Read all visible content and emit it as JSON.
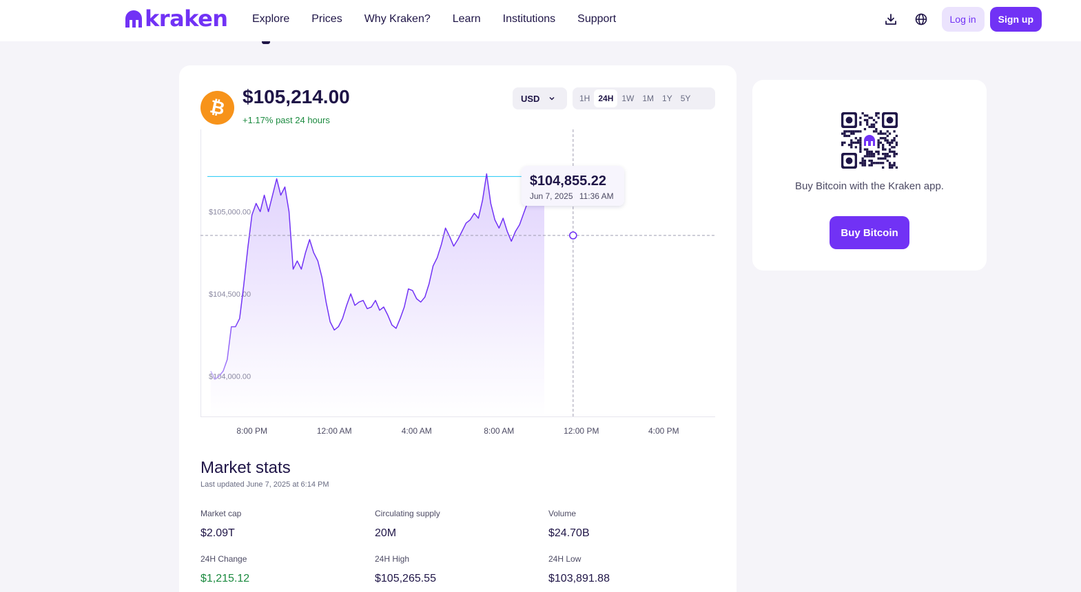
{
  "nav": {
    "logo_text": "kraken",
    "links": [
      "Explore",
      "Prices",
      "Why Kraken?",
      "Learn",
      "Institutions",
      "Support"
    ],
    "download_icon": "download-icon",
    "language_icon": "globe-icon",
    "login": "Log in",
    "signup": "Sign up"
  },
  "colors": {
    "brand": "#7132f5",
    "positive": "#1b8a3f",
    "marker": "#1ec8f5",
    "text": "#1f1547"
  },
  "asset": {
    "icon": "bitcoin-icon",
    "price": "$105,214.00",
    "change": "+1.17% past 24 hours"
  },
  "controls": {
    "currency": "USD",
    "ranges": [
      "1H",
      "24H",
      "1W",
      "1M",
      "1Y",
      "5Y"
    ],
    "active_range": "24H"
  },
  "chart_data": {
    "type": "area",
    "y_tick_labels": [
      "$105,000.00",
      "$104,500.00",
      "$104,000.00"
    ],
    "y_ticks": [
      105000,
      104500,
      104000
    ],
    "x_tick_labels": [
      "8:00 PM",
      "12:00 AM",
      "4:00 AM",
      "8:00 AM",
      "12:00 PM",
      "4:00 PM"
    ],
    "x_ticks": [
      20,
      24,
      28,
      32,
      36,
      40
    ],
    "xlim": [
      17.5,
      42.5
    ],
    "ylim": [
      103750,
      105500
    ],
    "grid": false,
    "current_value": 105214,
    "series": [
      {
        "points": [
          [
            18.0,
            104030
          ],
          [
            18.2,
            103980
          ],
          [
            18.4,
            104000
          ],
          [
            18.6,
            104030
          ],
          [
            18.8,
            104100
          ],
          [
            19.0,
            104300
          ],
          [
            19.2,
            104300
          ],
          [
            19.4,
            104350
          ],
          [
            19.6,
            104550
          ],
          [
            19.8,
            104780
          ],
          [
            20.0,
            104980
          ],
          [
            20.2,
            105050
          ],
          [
            20.4,
            105000
          ],
          [
            20.6,
            105100
          ],
          [
            20.8,
            105000
          ],
          [
            21.0,
            105100
          ],
          [
            21.2,
            105200
          ],
          [
            21.4,
            105100
          ],
          [
            21.6,
            105150
          ],
          [
            21.8,
            105000
          ],
          [
            22.0,
            104650
          ],
          [
            22.2,
            104700
          ],
          [
            22.4,
            104650
          ],
          [
            22.6,
            104750
          ],
          [
            22.8,
            104830
          ],
          [
            23.0,
            104750
          ],
          [
            23.2,
            104700
          ],
          [
            23.4,
            104600
          ],
          [
            23.6,
            104450
          ],
          [
            23.8,
            104330
          ],
          [
            24.0,
            104280
          ],
          [
            24.2,
            104300
          ],
          [
            24.4,
            104350
          ],
          [
            24.6,
            104430
          ],
          [
            24.8,
            104500
          ],
          [
            25.0,
            104430
          ],
          [
            25.2,
            104450
          ],
          [
            25.4,
            104460
          ],
          [
            25.6,
            104410
          ],
          [
            25.8,
            104420
          ],
          [
            26.0,
            104460
          ],
          [
            26.2,
            104400
          ],
          [
            26.4,
            104420
          ],
          [
            26.6,
            104370
          ],
          [
            26.8,
            104310
          ],
          [
            27.0,
            104290
          ],
          [
            27.2,
            104350
          ],
          [
            27.4,
            104420
          ],
          [
            27.6,
            104530
          ],
          [
            27.8,
            104520
          ],
          [
            28.0,
            104470
          ],
          [
            28.2,
            104450
          ],
          [
            28.4,
            104480
          ],
          [
            28.6,
            104560
          ],
          [
            28.8,
            104670
          ],
          [
            29.0,
            104720
          ],
          [
            29.2,
            104800
          ],
          [
            29.4,
            104900
          ],
          [
            29.6,
            104850
          ],
          [
            29.8,
            104790
          ],
          [
            30.0,
            104830
          ],
          [
            30.2,
            104880
          ],
          [
            30.4,
            104930
          ],
          [
            30.6,
            104950
          ],
          [
            30.8,
            104990
          ],
          [
            31.0,
            104960
          ],
          [
            31.2,
            105070
          ],
          [
            31.4,
            105230
          ],
          [
            31.6,
            105050
          ],
          [
            31.8,
            104950
          ],
          [
            32.0,
            104900
          ],
          [
            32.2,
            104960
          ],
          [
            32.4,
            104880
          ],
          [
            32.6,
            104820
          ],
          [
            32.8,
            104880
          ],
          [
            33.0,
            104920
          ],
          [
            33.2,
            104990
          ],
          [
            33.4,
            105060
          ],
          [
            33.6,
            105240
          ],
          [
            33.8,
            105250
          ],
          [
            34.0,
            105220
          ],
          [
            34.2,
            105210
          ]
        ]
      }
    ]
  },
  "tooltip": {
    "value": "$104,855.22",
    "date": "Jun 7, 2025",
    "time": "11:36 AM"
  },
  "stats": {
    "title": "Market stats",
    "updated": "Last updated June 7, 2025 at 6:14 PM",
    "items": [
      {
        "label": "Market cap",
        "value": "$2.09T"
      },
      {
        "label": "Circulating supply",
        "value": "20M"
      },
      {
        "label": "Volume",
        "value": "$24.70B"
      },
      {
        "label": "24H Change",
        "value": "$1,215.12"
      },
      {
        "label": "24H High",
        "value": "$105,265.55"
      },
      {
        "label": "24H Low",
        "value": "$103,891.88"
      }
    ]
  },
  "side": {
    "qr_icon": "qr-code-icon",
    "text": "Buy Bitcoin with the Kraken app.",
    "button": "Buy Bitcoin"
  }
}
